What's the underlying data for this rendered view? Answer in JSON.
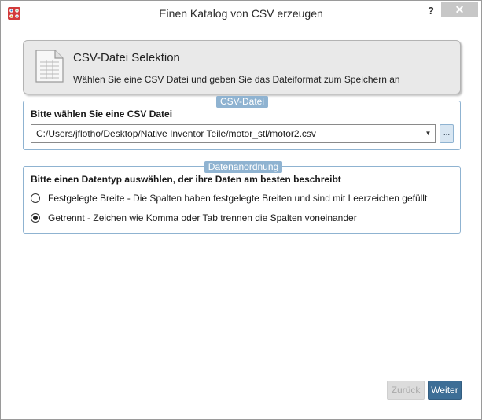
{
  "window": {
    "title": "Einen Katalog von CSV erzeugen",
    "help_label": "?",
    "close_label": "✕",
    "app_icon": "app-grid-icon"
  },
  "header": {
    "title": "CSV-Datei Selektion",
    "subtitle": "Wählen Sie eine CSV Datei und geben Sie das Dateiformat zum Speichern an",
    "icon": "csv-document-icon"
  },
  "csv_group": {
    "tab": "CSV-Datei",
    "label": "Bitte wählen Sie eine CSV Datei",
    "path_value": "C:/Users/jflotho/Desktop/Native Inventor Teile/motor_stl/motor2.csv",
    "dropdown_arrow": "▼",
    "browse_label": "..."
  },
  "data_group": {
    "tab": "Datenanordnung",
    "label": "Bitte einen Datentyp auswählen, der ihre Daten am besten beschreibt",
    "options": [
      {
        "label": "Festgelegte Breite - Die Spalten haben festgelegte Breiten und sind mit Leerzeichen gefüllt",
        "checked": false
      },
      {
        "label": "Getrennt - Zeichen wie Komma oder Tab trennen die Spalten voneinander",
        "checked": true
      }
    ]
  },
  "footer": {
    "back_label": "Zurück",
    "next_label": "Weiter"
  },
  "colors": {
    "accent": "#3d6e96",
    "group_border": "#8fb3d1"
  }
}
